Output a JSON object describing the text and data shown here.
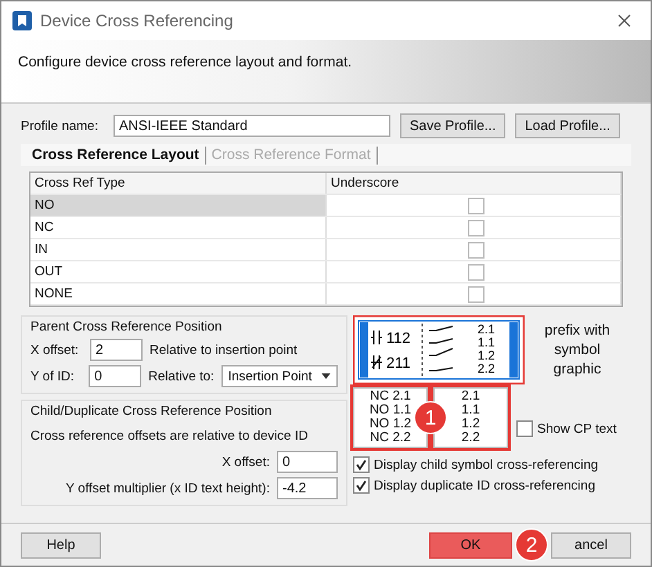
{
  "window": {
    "title": "Device Cross Referencing"
  },
  "header": {
    "description": "Configure device cross reference layout and format."
  },
  "profile": {
    "label": "Profile name:",
    "value": "ANSI-IEEE Standard",
    "buttons": [
      "Save Profile...",
      "Load Profile..."
    ]
  },
  "tabs": [
    {
      "label": "Cross Reference Layout",
      "selected": true
    },
    {
      "label": "Cross Reference Format",
      "selected": false
    }
  ],
  "table": {
    "columns": [
      "Cross Ref Type",
      "Underscore"
    ],
    "rows": [
      {
        "type": "NO",
        "underscore": false,
        "selected": true
      },
      {
        "type": "NC",
        "underscore": false,
        "selected": false
      },
      {
        "type": "IN",
        "underscore": false,
        "selected": false
      },
      {
        "type": "OUT",
        "underscore": false,
        "selected": false
      },
      {
        "type": "NONE",
        "underscore": false,
        "selected": false
      }
    ]
  },
  "parent_position": {
    "title": "Parent Cross Reference Position",
    "x_label": "X offset:",
    "x_value": "2",
    "x_note": "Relative to insertion point",
    "y_label": "Y of ID:",
    "y_value": "0",
    "relative_label": "Relative to:",
    "relative_value": "Insertion Point"
  },
  "parent_graphic": {
    "ids": [
      "112",
      "211"
    ],
    "refs": [
      "2.1",
      "1.1",
      "1.2",
      "2.2"
    ]
  },
  "prefix_label": "prefix with symbol graphic",
  "child_position": {
    "title": "Child/Duplicate Cross Reference Position",
    "note": "Cross reference offsets are relative to device ID",
    "x_label": "X offset:",
    "x_value": "0",
    "y_label": "Y offset multiplier (x ID text height):",
    "y_value": "-4.2"
  },
  "prefix_samples": [
    "NC 2.1",
    "NO 1.1",
    "NO 1.2",
    "NC 2.2"
  ],
  "plain_samples": [
    "2.1",
    "1.1",
    "1.2",
    "2.2"
  ],
  "show_cp": {
    "label": "Show CP  text",
    "checked": false
  },
  "options": [
    {
      "label": "Display child symbol cross-referencing",
      "checked": true
    },
    {
      "label": "Display duplicate ID cross-referencing",
      "checked": true
    }
  ],
  "footer": {
    "buttons": [
      {
        "label": "Help",
        "kind": "plain"
      },
      {
        "label": "OK",
        "kind": "highlighted"
      },
      {
        "label": "ancel",
        "kind": "plain"
      }
    ]
  },
  "callouts": [
    {
      "number": "1"
    },
    {
      "number": "2"
    }
  ]
}
